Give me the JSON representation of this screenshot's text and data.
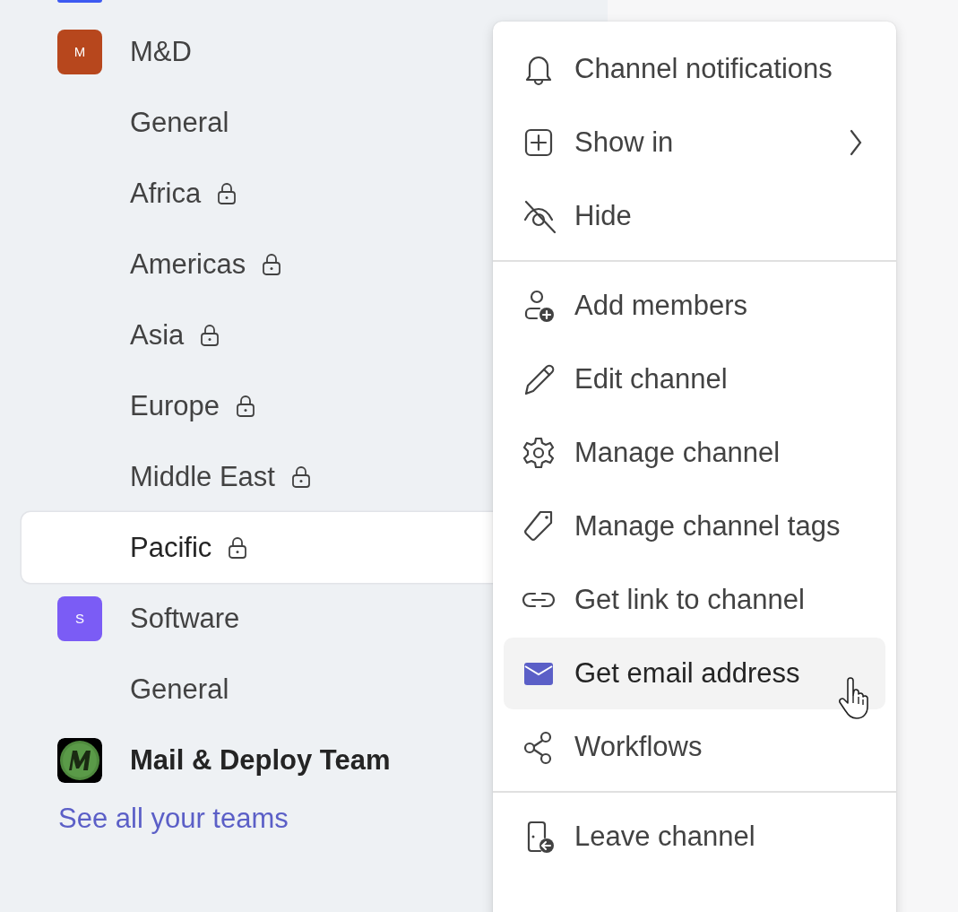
{
  "sidebar": {
    "teams": [
      {
        "kind": "clipped",
        "color": "#3d5af1"
      },
      {
        "kind": "letter",
        "name": "M&D",
        "letter": "M",
        "color": "#b7471d",
        "unread": false,
        "channels": [
          {
            "name": "General",
            "private": false,
            "selected": false
          },
          {
            "name": "Africa",
            "private": true,
            "selected": false
          },
          {
            "name": "Americas",
            "private": true,
            "selected": false
          },
          {
            "name": "Asia",
            "private": true,
            "selected": false
          },
          {
            "name": "Europe",
            "private": true,
            "selected": false
          },
          {
            "name": "Middle East",
            "private": true,
            "selected": false
          },
          {
            "name": "Pacific",
            "private": true,
            "selected": true
          }
        ]
      },
      {
        "kind": "letter",
        "name": "Software",
        "letter": "S",
        "color": "#7b5cf5",
        "unread": false,
        "channels": [
          {
            "name": "General",
            "private": false,
            "selected": false
          }
        ]
      },
      {
        "kind": "logo",
        "name": "Mail & Deploy Team",
        "unread": true
      }
    ],
    "see_all_link": "See all your teams"
  },
  "context_menu": {
    "groups": [
      [
        {
          "label": "Channel notifications",
          "kind": "bell",
          "submenu": false,
          "highlighted": false
        },
        {
          "label": "Show in",
          "kind": "plus-square",
          "submenu": true,
          "highlighted": false
        },
        {
          "label": "Hide",
          "kind": "eye-off",
          "submenu": false,
          "highlighted": false
        }
      ],
      [
        {
          "label": "Add members",
          "kind": "person-add",
          "submenu": false,
          "highlighted": false
        },
        {
          "label": "Edit channel",
          "kind": "pencil",
          "submenu": false,
          "highlighted": false
        },
        {
          "label": "Manage channel",
          "kind": "gear",
          "submenu": false,
          "highlighted": false
        },
        {
          "label": "Manage channel tags",
          "kind": "tag",
          "submenu": false,
          "highlighted": false
        },
        {
          "label": "Get link to channel",
          "kind": "link",
          "submenu": false,
          "highlighted": false
        },
        {
          "label": "Get email address",
          "kind": "mail",
          "submenu": false,
          "highlighted": true
        },
        {
          "label": "Workflows",
          "kind": "workflow",
          "submenu": false,
          "highlighted": false
        }
      ],
      [
        {
          "label": "Leave channel",
          "kind": "leave",
          "submenu": false,
          "highlighted": false
        }
      ]
    ]
  }
}
